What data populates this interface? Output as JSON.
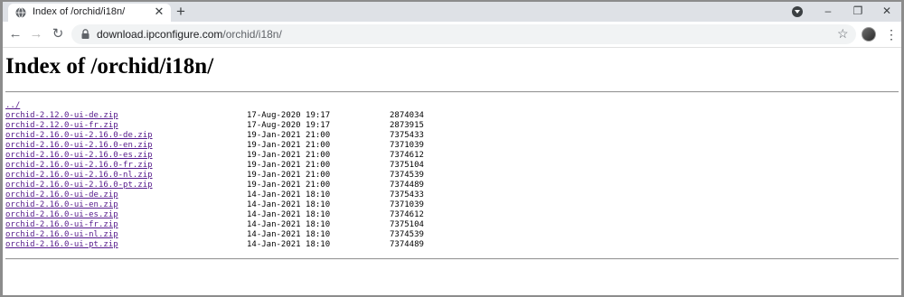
{
  "browser": {
    "tab": {
      "title": "Index of /orchid/i18n/",
      "favicon": "globe-icon"
    },
    "new_tab_label": "+",
    "url": {
      "host": "download.ipconfigure.com",
      "path": "/orchid/i18n/"
    },
    "window_controls": {
      "minimize": "–",
      "restore": "❐",
      "close": "✕"
    }
  },
  "page": {
    "title": "Index of /orchid/i18n/",
    "parent_link": "../",
    "files": [
      {
        "name": "orchid-2.12.0-ui-de.zip",
        "date": "17-Aug-2020 19:17",
        "size": "2874034"
      },
      {
        "name": "orchid-2.12.0-ui-fr.zip",
        "date": "17-Aug-2020 19:17",
        "size": "2873915"
      },
      {
        "name": "orchid-2.16.0-ui-2.16.0-de.zip",
        "date": "19-Jan-2021 21:00",
        "size": "7375433"
      },
      {
        "name": "orchid-2.16.0-ui-2.16.0-en.zip",
        "date": "19-Jan-2021 21:00",
        "size": "7371039"
      },
      {
        "name": "orchid-2.16.0-ui-2.16.0-es.zip",
        "date": "19-Jan-2021 21:00",
        "size": "7374612"
      },
      {
        "name": "orchid-2.16.0-ui-2.16.0-fr.zip",
        "date": "19-Jan-2021 21:00",
        "size": "7375104"
      },
      {
        "name": "orchid-2.16.0-ui-2.16.0-nl.zip",
        "date": "19-Jan-2021 21:00",
        "size": "7374539"
      },
      {
        "name": "orchid-2.16.0-ui-2.16.0-pt.zip",
        "date": "19-Jan-2021 21:00",
        "size": "7374489"
      },
      {
        "name": "orchid-2.16.0-ui-de.zip",
        "date": "14-Jan-2021 18:10",
        "size": "7375433"
      },
      {
        "name": "orchid-2.16.0-ui-en.zip",
        "date": "14-Jan-2021 18:10",
        "size": "7371039"
      },
      {
        "name": "orchid-2.16.0-ui-es.zip",
        "date": "14-Jan-2021 18:10",
        "size": "7374612"
      },
      {
        "name": "orchid-2.16.0-ui-fr.zip",
        "date": "14-Jan-2021 18:10",
        "size": "7375104"
      },
      {
        "name": "orchid-2.16.0-ui-nl.zip",
        "date": "14-Jan-2021 18:10",
        "size": "7374539"
      },
      {
        "name": "orchid-2.16.0-ui-pt.zip",
        "date": "14-Jan-2021 18:10",
        "size": "7374489"
      }
    ]
  },
  "colors": {
    "link": "#551a8b",
    "tabstrip": "#dee1e6",
    "omnibox": "#f1f3f4"
  }
}
